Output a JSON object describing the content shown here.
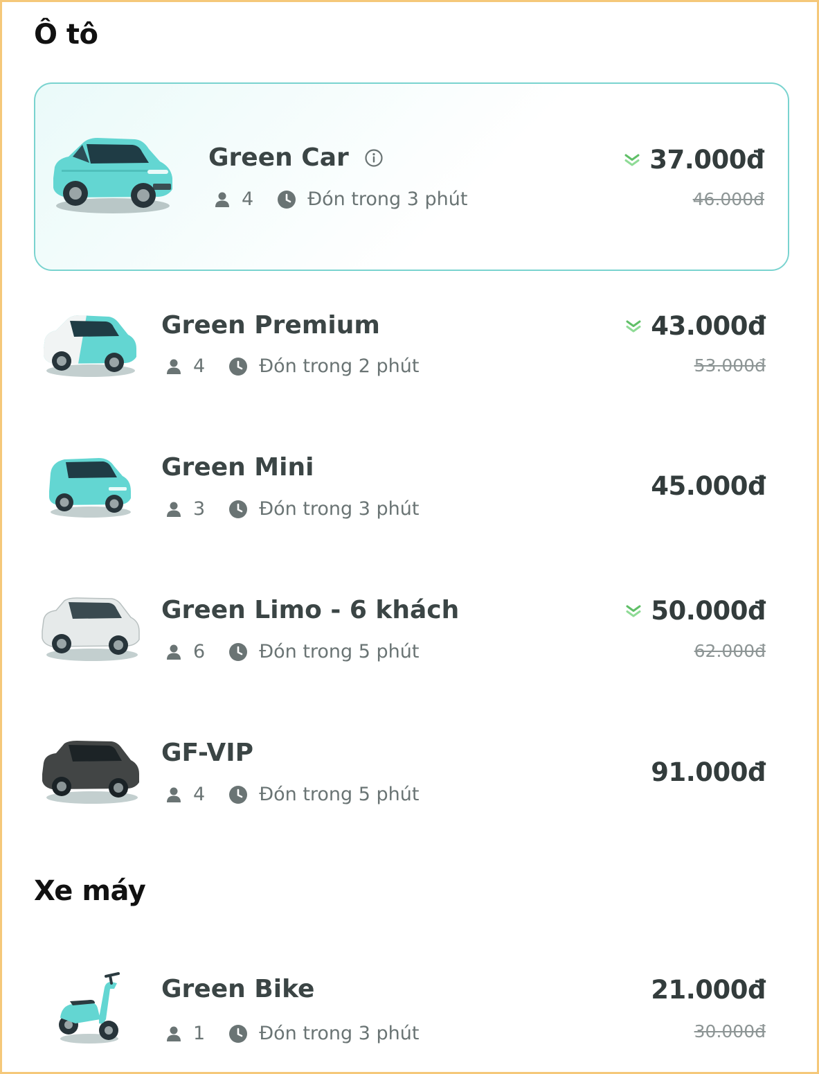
{
  "sections": [
    {
      "title": "Ô tô",
      "items": [
        {
          "name": "Green Car",
          "seats": "4",
          "eta": "Đón trong 3 phút",
          "price": "37.000đ",
          "old_price": "46.000đ",
          "selected": true,
          "has_info_icon": true,
          "has_discount_icon": true,
          "vehicle_icon": "teal-suv-car",
          "vehicle_color": "#63d6d2"
        },
        {
          "name": "Green Premium",
          "seats": "4",
          "eta": "Đón trong 2 phút",
          "price": "43.000đ",
          "old_price": "53.000đ",
          "has_discount_icon": true,
          "vehicle_icon": "teal-white-suv-car",
          "vehicle_color": "#63d6d2"
        },
        {
          "name": "Green Mini",
          "seats": "3",
          "eta": "Đón trong 3 phút",
          "price": "45.000đ",
          "vehicle_icon": "teal-mini-car",
          "vehicle_color": "#63d6d2"
        },
        {
          "name": "Green Limo - 6 khách",
          "seats": "6",
          "eta": "Đón trong 5 phút",
          "price": "50.000đ",
          "old_price": "62.000đ",
          "has_discount_icon": true,
          "vehicle_icon": "white-suv-car",
          "vehicle_color": "#e6eaea"
        },
        {
          "name": "GF-VIP",
          "seats": "4",
          "eta": "Đón trong 5 phút",
          "price": "91.000đ",
          "vehicle_icon": "black-suv-car",
          "vehicle_color": "#424545"
        }
      ]
    },
    {
      "title": "Xe máy",
      "items": [
        {
          "name": "Green Bike",
          "seats": "1",
          "eta": "Đón trong 3 phút",
          "price": "21.000đ",
          "old_price": "30.000đ",
          "vehicle_icon": "teal-scooter",
          "vehicle_color": "#63d6d2"
        }
      ]
    }
  ],
  "icons": {
    "seats": "person-icon",
    "eta": "clock-icon",
    "info": "info-icon",
    "discount": "double-chevron-down-icon"
  },
  "colors": {
    "accent": "#63d6d2",
    "selected_border": "#79d3cf",
    "discount_icon": "#5fbf67",
    "meta_icon": "#6a7474",
    "page_border": "#f5c87a"
  }
}
